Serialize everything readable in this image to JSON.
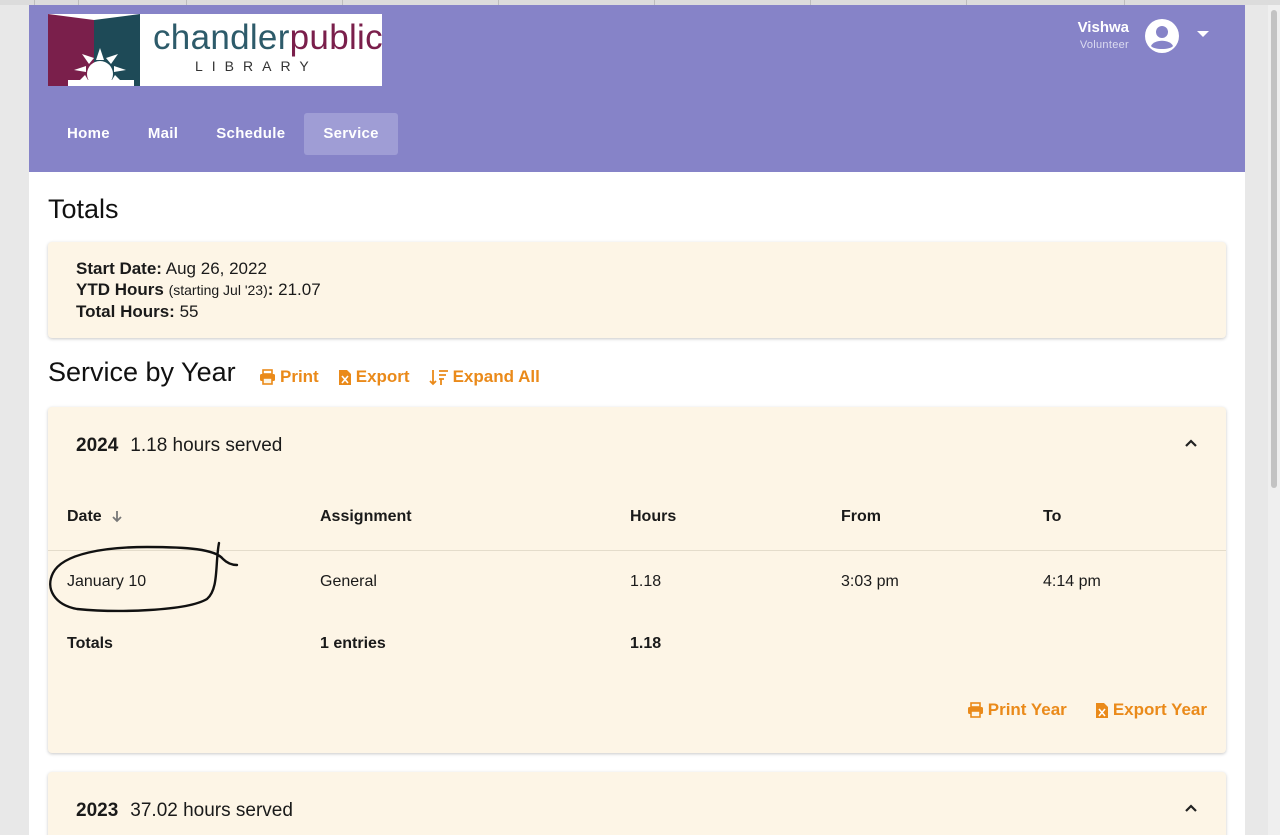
{
  "header": {
    "logo": {
      "name_part1": "chandler",
      "name_part2": "public",
      "subtitle": "LIBRARY"
    },
    "user": {
      "name": "Vishwa",
      "role": "Volunteer"
    },
    "nav": [
      {
        "label": "Home",
        "active": false
      },
      {
        "label": "Mail",
        "active": false
      },
      {
        "label": "Schedule",
        "active": false
      },
      {
        "label": "Service",
        "active": true
      }
    ]
  },
  "totals": {
    "title": "Totals",
    "start_date_label": "Start Date:",
    "start_date": "Aug 26, 2022",
    "ytd_label": "YTD Hours",
    "ytd_note": "(starting Jul '23)",
    "ytd_value": "21.07",
    "total_label": "Total Hours:",
    "total_value": "55"
  },
  "service": {
    "title": "Service by Year",
    "actions": {
      "print": "Print",
      "export": "Export",
      "expand": "Expand All"
    },
    "columns": [
      "Date",
      "Assignment",
      "Hours",
      "From",
      "To"
    ],
    "years": [
      {
        "year": "2024",
        "summary": "1.18 hours served",
        "rows": [
          {
            "date": "January 10",
            "assignment": "General",
            "hours": "1.18",
            "from": "3:03 pm",
            "to": "4:14 pm"
          }
        ],
        "totals": {
          "label": "Totals",
          "entries": "1 entries",
          "hours": "1.18"
        },
        "print_label": "Print Year",
        "export_label": "Export Year"
      },
      {
        "year": "2023",
        "summary": "37.02 hours served"
      }
    ]
  },
  "colors": {
    "header": "#8683c8",
    "nav_active": "#9f9dd5",
    "card": "#fdf5e6",
    "accent": "#ea8a1a"
  },
  "icons": [
    "printer-icon",
    "excel-file-icon",
    "sort-expand-icon",
    "sort-arrow-down-icon",
    "chevron-up-icon",
    "account-circle-icon",
    "caret-down-icon"
  ]
}
